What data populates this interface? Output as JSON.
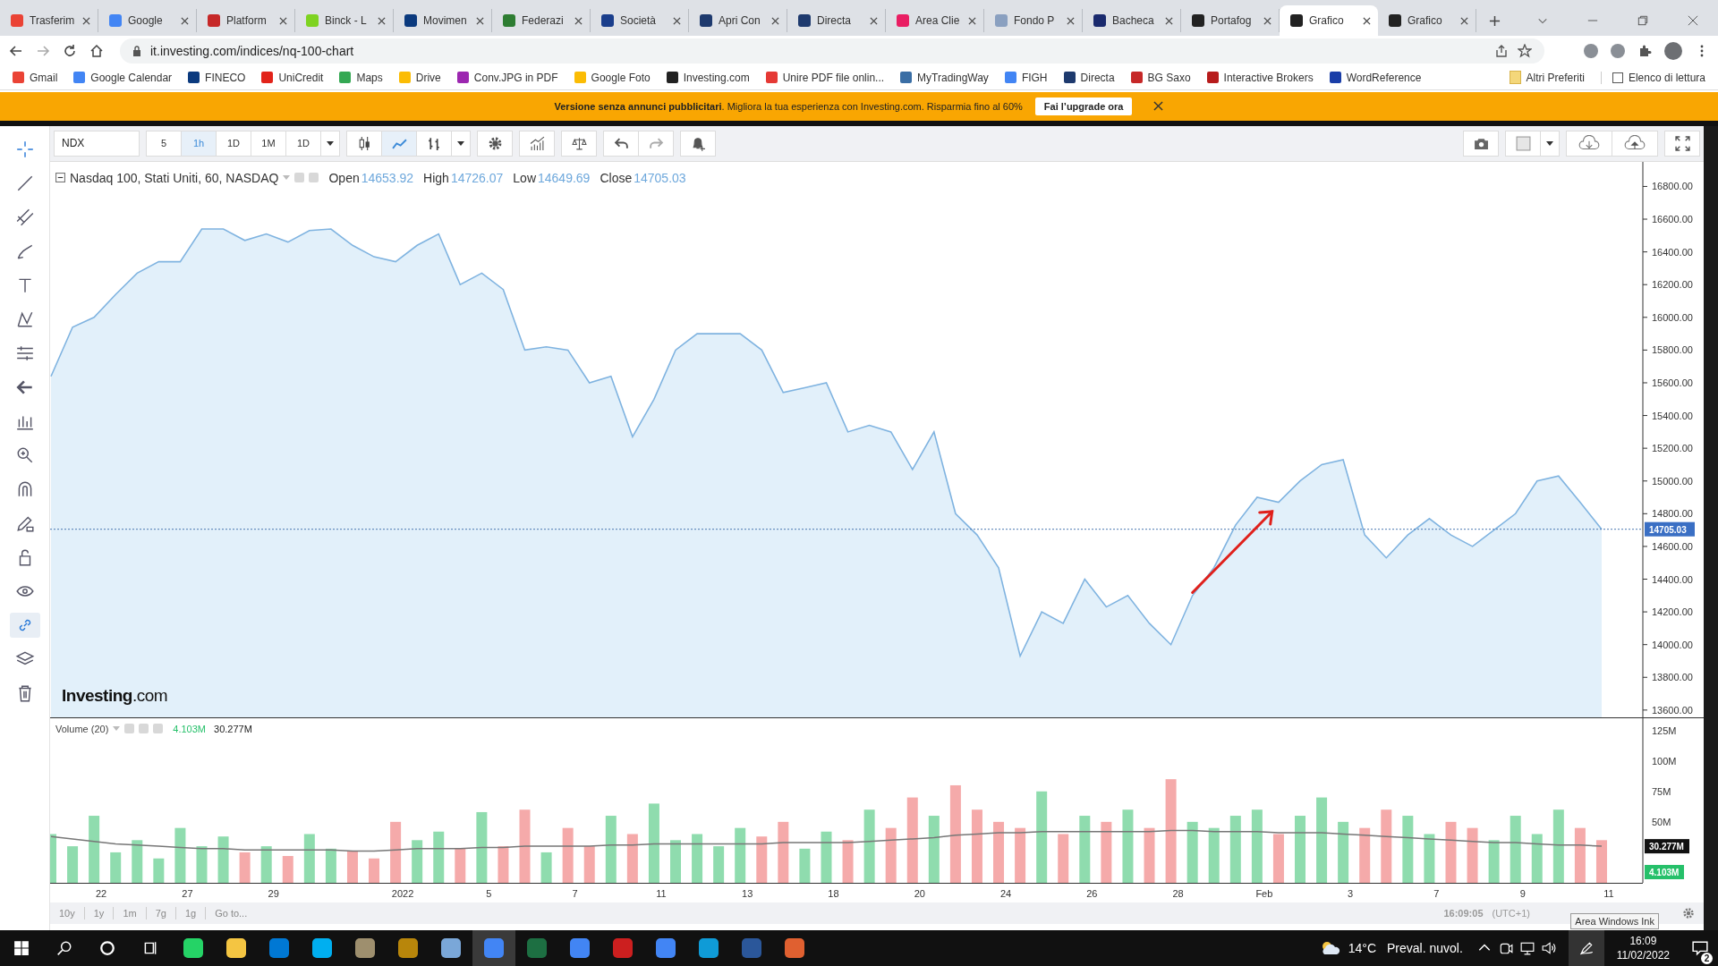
{
  "browser": {
    "tabs": [
      {
        "title": "Trasferim",
        "selected": false,
        "color": "#ea4335"
      },
      {
        "title": "Google",
        "selected": false,
        "color": "#4285f4"
      },
      {
        "title": "Platform",
        "selected": false,
        "color": "#c62828"
      },
      {
        "title": "Binck - L",
        "selected": false,
        "color": "#7ed321"
      },
      {
        "title": "Movimen",
        "selected": false,
        "color": "#0b3a7e"
      },
      {
        "title": "Federazi",
        "selected": false,
        "color": "#2e7d32"
      },
      {
        "title": "Società",
        "selected": false,
        "color": "#1a3e8c"
      },
      {
        "title": "Apri Con",
        "selected": false,
        "color": "#1e3a6e"
      },
      {
        "title": "Directa",
        "selected": false,
        "color": "#1e3a6e"
      },
      {
        "title": "Area Clie",
        "selected": false,
        "color": "#e91e63"
      },
      {
        "title": "Fondo P",
        "selected": false,
        "color": "#8aa0c0"
      },
      {
        "title": "Bacheca",
        "selected": false,
        "color": "#1a2a6e"
      },
      {
        "title": "Portafog",
        "selected": false,
        "color": "#222222"
      },
      {
        "title": "Grafico",
        "selected": true,
        "color": "#222222"
      },
      {
        "title": "Grafico",
        "selected": false,
        "color": "#222222"
      }
    ],
    "address": "it.investing.com/indices/nq-100-chart",
    "bookmarks": [
      {
        "label": "Gmail",
        "color": "#ea4335"
      },
      {
        "label": "Google Calendar",
        "color": "#4285f4"
      },
      {
        "label": "FINECO",
        "color": "#0b3a7e"
      },
      {
        "label": "UniCredit",
        "color": "#e2231a"
      },
      {
        "label": "Maps",
        "color": "#34a853"
      },
      {
        "label": "Drive",
        "color": "#fbbc04"
      },
      {
        "label": "Conv.JPG in PDF",
        "color": "#9c27b0"
      },
      {
        "label": "Google Foto",
        "color": "#fbbc04"
      },
      {
        "label": "Investing.com",
        "color": "#222222"
      },
      {
        "label": "Unire PDF file onlin...",
        "color": "#e53935"
      },
      {
        "label": "MyTradingWay",
        "color": "#3a6ea5"
      },
      {
        "label": "FIGH",
        "color": "#4285f4"
      },
      {
        "label": "Directa",
        "color": "#1e3a6e"
      },
      {
        "label": "BG Saxo",
        "color": "#c62828"
      },
      {
        "label": "Interactive Brokers",
        "color": "#b71c1c"
      },
      {
        "label": "WordReference",
        "color": "#1a3ea8"
      }
    ],
    "other_bookmarks": [
      "Altri Preferiti",
      "Elenco di lettura"
    ]
  },
  "banner": {
    "text": "**Versione senza annunci pubblicitari**. Migliora la tua esperienza con Investing.com. Risparmia fino al 60%",
    "button": "Fai l’upgrade ora"
  },
  "chart": {
    "symbol": "NDX",
    "intervals": [
      {
        "label": "5",
        "selected": false
      },
      {
        "label": "1h",
        "selected": true
      },
      {
        "label": "1D",
        "selected": false
      },
      {
        "label": "1M",
        "selected": false
      },
      {
        "label": "1D",
        "selected": false
      }
    ],
    "legend": {
      "title": "Nasdaq 100, Stati Uniti, 60, NASDAQ",
      "fields": [
        {
          "label": "Open",
          "value": "14653.92"
        },
        {
          "label": "High",
          "value": "14726.07"
        },
        {
          "label": "Low",
          "value": "14649.69"
        },
        {
          "label": "Close",
          "value": "14705.03"
        }
      ]
    },
    "logo": "**Investing**.com",
    "price": {
      "chart_data": {
        "type": "area",
        "ylim": [
          13550,
          16950
        ],
        "ref_lines": [
          {
            "axis": "y",
            "value": 14705.03,
            "label": "14705.03"
          }
        ],
        "yticks": [
          {
            "value": 16800,
            "label": "16800.00"
          },
          {
            "value": 16600,
            "label": "16600.00"
          },
          {
            "value": 16400,
            "label": "16400.00"
          },
          {
            "value": 16200,
            "label": "16200.00"
          },
          {
            "value": 16000,
            "label": "16000.00"
          },
          {
            "value": 15800,
            "label": "15800.00"
          },
          {
            "value": 15600,
            "label": "15600.00"
          },
          {
            "value": 15400,
            "label": "15400.00"
          },
          {
            "value": 15200,
            "label": "15200.00"
          },
          {
            "value": 15000,
            "label": "15000.00"
          },
          {
            "value": 14800,
            "label": "14800.00"
          },
          {
            "value": 14600,
            "label": "14600.00"
          },
          {
            "value": 14400,
            "label": "14400.00"
          },
          {
            "value": 14200,
            "label": "14200.00"
          },
          {
            "value": 14000,
            "label": "14000.00"
          },
          {
            "value": 13800,
            "label": "13800.00"
          },
          {
            "value": 13600,
            "label": "13600.00"
          }
        ],
        "series": [
          {
            "color": "#7fb3e0",
            "values": [
              15640,
              15940,
              16000,
              16140,
              16270,
              16340,
              16340,
              16540,
              16540,
              16470,
              16510,
              16460,
              16530,
              16540,
              16440,
              16370,
              16340,
              16440,
              16510,
              16200,
              16270,
              16170,
              15800,
              15820,
              15800,
              15600,
              15640,
              15270,
              15500,
              15800,
              15900,
              15900,
              15900,
              15800,
              15540,
              15570,
              15600,
              15300,
              15340,
              15300,
              15070,
              15300,
              14800,
              14670,
              14470,
              13930,
              14200,
              14130,
              14400,
              14230,
              14300,
              14130,
              14000,
              14300,
              14470,
              14730,
              14900,
              14870,
              15000,
              15100,
              15130,
              14670,
              14530,
              14670,
              14770,
              14670,
              14600,
              14700,
              14800,
              15000,
              15030,
              14870,
              14705
            ]
          }
        ]
      }
    },
    "volume": {
      "title": "Volume (20)",
      "value": "4.103M",
      "average": "30.277M",
      "badge_average": "30.277M",
      "badge_value": "4.103M",
      "chart_data": {
        "type": "bar",
        "stacked": true,
        "ylim": [
          0,
          135
        ],
        "categories": [
          null,
          null,
          "22",
          null,
          null,
          null,
          "27",
          null,
          null,
          null,
          "29",
          null,
          null,
          null,
          null,
          null,
          "2022",
          null,
          null,
          null,
          "5",
          null,
          null,
          null,
          "7",
          null,
          null,
          null,
          "11",
          null,
          null,
          null,
          "13",
          null,
          null,
          null,
          "18",
          null,
          null,
          null,
          "20",
          null,
          null,
          null,
          "24",
          null,
          null,
          null,
          "26",
          null,
          null,
          null,
          "28",
          null,
          null,
          null,
          "Feb",
          null,
          null,
          null,
          "3",
          null,
          null,
          null,
          "7",
          null,
          null,
          null,
          "9",
          null,
          null,
          null,
          "11"
        ],
        "yticks": [
          {
            "value": 125,
            "label": "125M"
          },
          {
            "value": 100,
            "label": "100M"
          },
          {
            "value": 75,
            "label": "75M"
          },
          {
            "value": 50,
            "label": "50M"
          }
        ],
        "series": [
          {
            "color": "#8fdcae",
            "values": [
              40,
              30,
              55,
              25,
              35,
              20,
              45,
              30,
              38,
              null,
              30,
              null,
              40,
              28,
              null,
              null,
              null,
              35,
              42,
              null,
              58,
              null,
              null,
              25,
              null,
              null,
              55,
              null,
              65,
              35,
              40,
              30,
              45,
              null,
              null,
              28,
              42,
              null,
              60,
              null,
              null,
              55,
              null,
              null,
              null,
              null,
              75,
              null,
              55,
              null,
              60,
              null,
              null,
              50,
              45,
              55,
              60,
              null,
              55,
              70,
              50,
              null,
              null,
              55,
              40,
              null,
              null,
              35,
              55,
              40,
              60,
              null,
              null
            ]
          },
          {
            "color": "#f5aaaa",
            "values": [
              null,
              null,
              null,
              null,
              null,
              null,
              null,
              null,
              null,
              25,
              null,
              22,
              null,
              null,
              26,
              20,
              50,
              null,
              null,
              28,
              null,
              30,
              60,
              null,
              45,
              30,
              null,
              40,
              null,
              null,
              null,
              null,
              null,
              38,
              50,
              null,
              null,
              35,
              null,
              45,
              70,
              null,
              80,
              60,
              50,
              45,
              null,
              40,
              null,
              50,
              null,
              45,
              85,
              null,
              null,
              null,
              null,
              40,
              null,
              null,
              null,
              45,
              60,
              null,
              null,
              50,
              45,
              null,
              null,
              null,
              null,
              45,
              35
            ]
          },
          {
            "type": "line",
            "color": "#777777",
            "values": [
              38,
              36,
              34,
              32,
              31,
              30,
              29,
              28,
              28,
              27,
              27,
              27,
              27,
              27,
              26,
              26,
              27,
              28,
              28,
              28,
              29,
              29,
              30,
              30,
              30,
              30,
              31,
              31,
              32,
              32,
              32,
              32,
              32,
              32,
              33,
              33,
              33,
              33,
              34,
              35,
              36,
              37,
              39,
              40,
              41,
              41,
              42,
              42,
              42,
              42,
              42,
              42,
              43,
              43,
              42,
              42,
              42,
              41,
              41,
              41,
              40,
              39,
              38,
              37,
              36,
              35,
              34,
              33,
              33,
              32,
              31,
              31,
              30
            ]
          }
        ]
      }
    },
    "ranges": [
      "10y",
      "1y",
      "1m",
      "7g",
      "1g"
    ],
    "goto": "Go to...",
    "time": "16:09:05",
    "timezone": "(UTC+1)",
    "tooltip": "Area Windows Ink"
  },
  "taskbar": {
    "temperature": "14°C",
    "weather": "Preval. nuvol.",
    "time": "16:09",
    "date": "11/02/2022",
    "notifications": "2"
  }
}
